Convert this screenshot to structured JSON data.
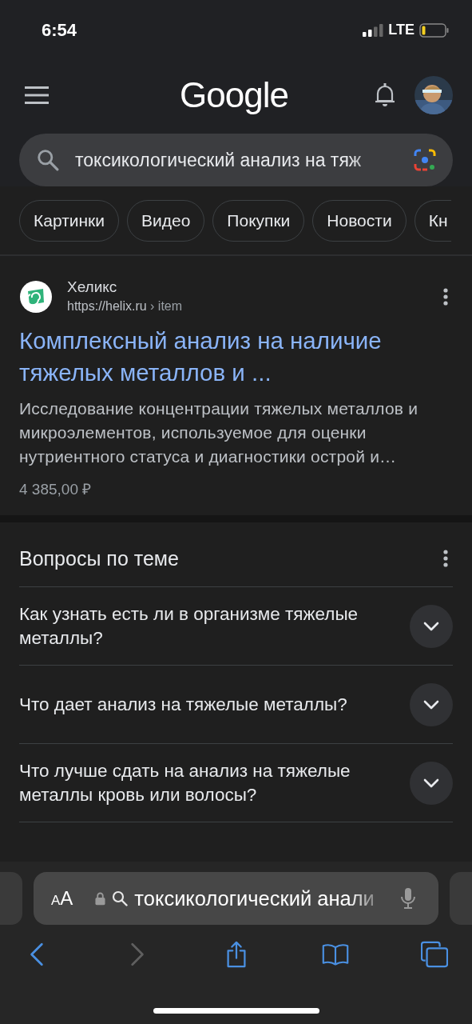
{
  "status_bar": {
    "time": "6:54",
    "network": "LTE"
  },
  "header": {
    "logo": "Google"
  },
  "search": {
    "value": "токсикологический анализ на тяж"
  },
  "chips": [
    {
      "label": "Картинки"
    },
    {
      "label": "Видео"
    },
    {
      "label": "Покупки"
    },
    {
      "label": "Новости"
    },
    {
      "label": "Кн"
    }
  ],
  "result": {
    "site": "Хеликс",
    "url": "https://helix.ru",
    "path": "› item",
    "title": "Комплексный анализ на наличие тяжелых металлов и ...",
    "snippet": "Исследование концентрации тяжелых металлов и микроэлементов, используемое для оценки нутриентного статуса и диагностики острой и…",
    "price": "4 385,00 ₽"
  },
  "related": {
    "title": "Вопросы по теме",
    "questions": [
      {
        "text": "Как узнать есть ли в организме тяжелые металлы?",
        "expanded": false
      },
      {
        "text": "Что дает анализ на тяжелые металлы?",
        "expanded": false
      },
      {
        "text": "Что лучше сдать на анализ на тяжелые металлы кровь или волосы?",
        "expanded": false
      }
    ]
  },
  "address_bar": {
    "text_size": "AA",
    "value": "токсикологический анали"
  },
  "toolbar": {
    "back": {
      "disabled": false
    },
    "forward": {
      "disabled": true
    }
  }
}
